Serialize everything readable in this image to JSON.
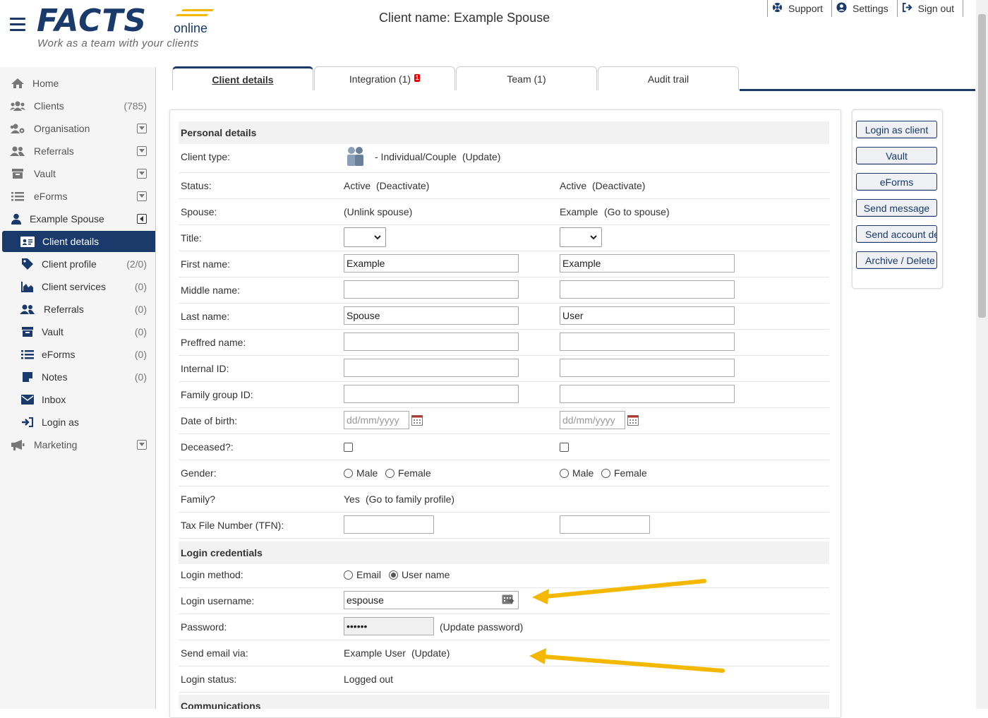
{
  "header": {
    "logo_text": "FACTS",
    "logo_online": "online",
    "logo_tagline": "Work as a team with your clients",
    "page_title": "Client name: Example Spouse",
    "links": [
      {
        "label": "Support",
        "icon": "lifebuoy-icon"
      },
      {
        "label": "Settings",
        "icon": "user-circle-icon"
      },
      {
        "label": "Sign out",
        "icon": "sign-out-icon"
      }
    ]
  },
  "sidebar": {
    "items": [
      {
        "label": "Home",
        "icon": "home-icon"
      },
      {
        "label": "Clients",
        "count": "(785)",
        "icon": "users-icon"
      },
      {
        "label": "Organisation",
        "icon": "users-cog-icon"
      },
      {
        "label": "Referrals",
        "icon": "user-friends-icon"
      },
      {
        "label": "Vault",
        "icon": "archive-icon"
      },
      {
        "label": "eForms",
        "icon": "list-icon"
      },
      {
        "label": "Example Spouse",
        "icon": "user-icon"
      },
      {
        "label": "Client details",
        "icon": "id-card-icon"
      },
      {
        "label": "Client profile",
        "count": "(2/0)",
        "icon": "tag-icon"
      },
      {
        "label": "Client services",
        "count": "(0)",
        "icon": "chart-area-icon"
      },
      {
        "label": "Referrals",
        "count": "(0)",
        "icon": "user-friends-icon"
      },
      {
        "label": "Vault",
        "count": "(0)",
        "icon": "archive-icon"
      },
      {
        "label": "eForms",
        "count": "(0)",
        "icon": "list-icon"
      },
      {
        "label": "Notes",
        "count": "(0)",
        "icon": "note-icon"
      },
      {
        "label": "Inbox",
        "icon": "envelope-icon"
      },
      {
        "label": "Login as",
        "icon": "sign-in-icon"
      },
      {
        "label": "Marketing",
        "icon": "bullhorn-icon"
      }
    ]
  },
  "tabs": [
    {
      "label": "Client details"
    },
    {
      "label": "Integration (1)",
      "badge": "1"
    },
    {
      "label": "Team (1)"
    },
    {
      "label": "Audit trail"
    }
  ],
  "personal": {
    "heading": "Personal details",
    "client_type_label": "Client type:",
    "client_type_value": "- Individual/Couple",
    "update": "(Update)",
    "status_label": "Status:",
    "status_a": "Active",
    "status_b": "Active",
    "deactivate": "(Deactivate)",
    "spouse_label": "Spouse:",
    "unlink_spouse": "(Unlink spouse)",
    "spouse_b_name": "Example",
    "go_to_spouse": "(Go to spouse)",
    "title_label": "Title:",
    "first_name_label": "First name:",
    "first_name_a": "Example",
    "first_name_b": "Example",
    "middle_name_label": "Middle name:",
    "last_name_label": "Last name:",
    "last_name_a": "Spouse",
    "last_name_b": "User",
    "preferred_name_label": "Preffred name:",
    "internal_id_label": "Internal ID:",
    "family_group_label": "Family group ID:",
    "dob_label": "Date of birth:",
    "dob_placeholder": "dd/mm/yyyy",
    "deceased_label": "Deceased?:",
    "gender_label": "Gender:",
    "male": "Male",
    "female": "Female",
    "family_label": "Family?",
    "family_value": "Yes",
    "go_to_family": "(Go to family profile)",
    "tfn_label": "Tax File Number (TFN):"
  },
  "login": {
    "heading": "Login credentials",
    "method_label": "Login method:",
    "method_email": "Email",
    "method_username": "User name",
    "username_label": "Login username:",
    "username_value": "espouse",
    "password_label": "Password:",
    "password_value": "••••••",
    "update_password": "(Update password)",
    "send_email_label": "Send email via:",
    "send_email_value": "Example User",
    "send_email_update": "(Update)",
    "status_label": "Login status:",
    "status_value": "Logged out"
  },
  "communications": {
    "heading": "Communications"
  },
  "actions": [
    {
      "label": "Login as client"
    },
    {
      "label": "Vault"
    },
    {
      "label": "eForms"
    },
    {
      "label": "Send message"
    },
    {
      "label": "Send account details"
    },
    {
      "label": "Archive / Delete"
    }
  ],
  "colors": {
    "brand": "#1a3a6b",
    "accent": "#f5b800",
    "arrow": "#f5b800",
    "badge": "#e00000"
  }
}
